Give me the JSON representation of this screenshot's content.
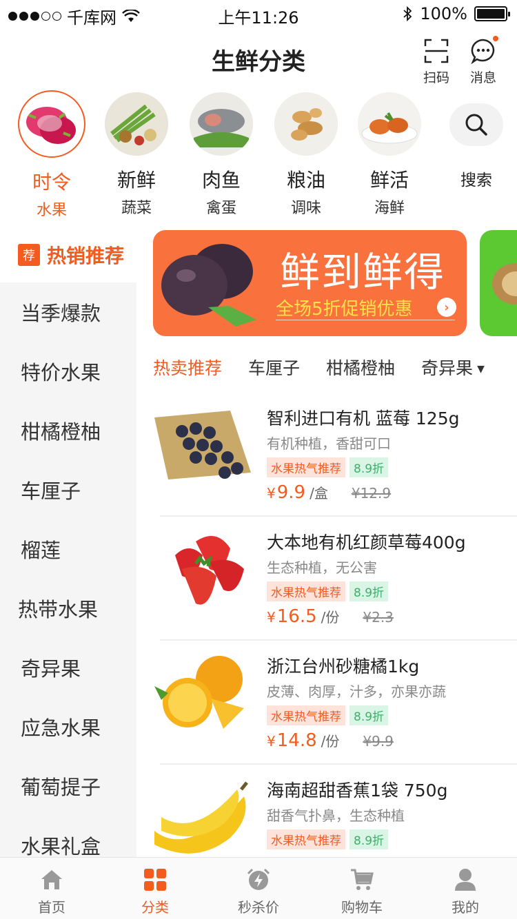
{
  "status_bar": {
    "carrier": "千库网",
    "time": "上午11:26",
    "battery": "100%"
  },
  "header": {
    "title": "生鲜分类",
    "scan_label": "扫码",
    "message_label": "消息"
  },
  "categories": [
    {
      "line1": "时令",
      "line2": "水果",
      "active": true
    },
    {
      "line1": "新鲜",
      "line2": "蔬菜"
    },
    {
      "line1": "肉鱼",
      "line2": "禽蛋"
    },
    {
      "line1": "粮油",
      "line2": "调味"
    },
    {
      "line1": "鲜活",
      "line2": "海鲜"
    }
  ],
  "search": {
    "label": "搜索"
  },
  "sidebar": {
    "badge": "荐",
    "hot_label": "热销推荐",
    "items": [
      "当季爆款",
      "特价水果",
      "柑橘橙柚",
      "车厘子",
      "榴莲",
      "热带水果",
      "奇异果",
      "应急水果",
      "葡萄提子",
      "水果礼盒"
    ]
  },
  "banner": {
    "title": "鲜到鲜得",
    "subtitle": "全场5折促销优惠"
  },
  "tabs": [
    "热卖推荐",
    "车厘子",
    "柑橘橙柚",
    "奇异果"
  ],
  "products": [
    {
      "name": "智利进口有机 蓝莓 125g",
      "desc": "有机种植，香甜可口",
      "tag": "水果热气推荐",
      "discount": "8.9折",
      "currency": "¥",
      "price": "9.9",
      "unit": "/盒",
      "original": "¥12.9"
    },
    {
      "name": "大本地有机红颜草莓400g",
      "desc": "生态种植，无公害",
      "tag": "水果热气推荐",
      "discount": "8.9折",
      "currency": "¥",
      "price": "16.5",
      "unit": "/份",
      "original": "¥2.3"
    },
    {
      "name": "浙江台州砂糖橘1kg",
      "desc": "皮薄、肉厚，汁多，亦果亦蔬",
      "tag": "水果热气推荐",
      "discount": "8.9折",
      "currency": "¥",
      "price": "14.8",
      "unit": "/份",
      "original": "¥9.9"
    },
    {
      "name": "海南超甜香蕉1袋 750g",
      "desc": "甜香气扑鼻，生态种植",
      "tag": "水果热气推荐",
      "discount": "8.9折",
      "currency": "¥",
      "price": "",
      "unit": "",
      "original": ""
    }
  ],
  "bottom_nav": [
    "首页",
    "分类",
    "秒杀价",
    "购物车",
    "我的"
  ],
  "colors": {
    "accent": "#f35b1f",
    "banner": "#f9713d",
    "discount_green": "#3bb06a"
  }
}
